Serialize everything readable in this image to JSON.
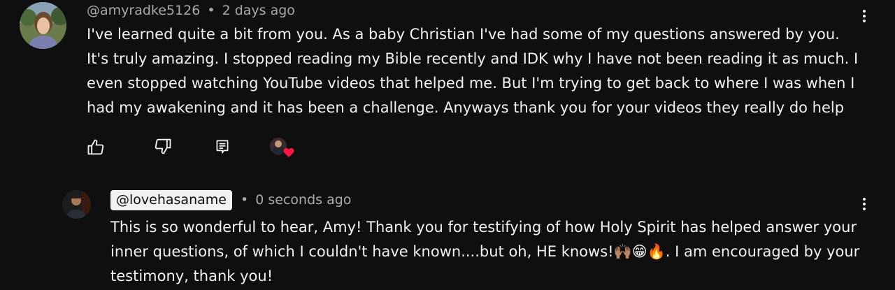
{
  "comment": {
    "author": "@amyradke5126",
    "separator": "•",
    "time": "2 days ago",
    "text": "I've learned quite a bit from you. As a baby Christian I've had some of my questions answered by you. It's truly amazing. I stopped reading my Bible recently and IDK why I have not been reading it as much. I even stopped watching YouTube videos that helped me. But I'm trying to get back to where I was when I had my awakening and it has been a challenge. Anyways thank you for your videos they really do help",
    "actions": {
      "like_icon": "thumbs-up-icon",
      "dislike_icon": "thumbs-down-icon",
      "reply_icon": "reply-icon",
      "heart_icon": "creator-heart-icon"
    }
  },
  "reply": {
    "author": "@lovehasaname",
    "separator": "•",
    "time": "0 seconds ago",
    "text_part1": "This is so wonderful to hear, Amy! Thank you for testifying of how Holy Spirit has helped answer your inner questions, of which I couldn't have known....but oh, HE knows!",
    "emojis": "🙌🏽😁🔥",
    "text_part2": ". I am encouraged by your testimony, thank you!"
  },
  "colors": {
    "background": "#0f0f0f",
    "text": "#f1f1f1",
    "meta": "#aaaaaa",
    "heart": "#ff1744"
  }
}
